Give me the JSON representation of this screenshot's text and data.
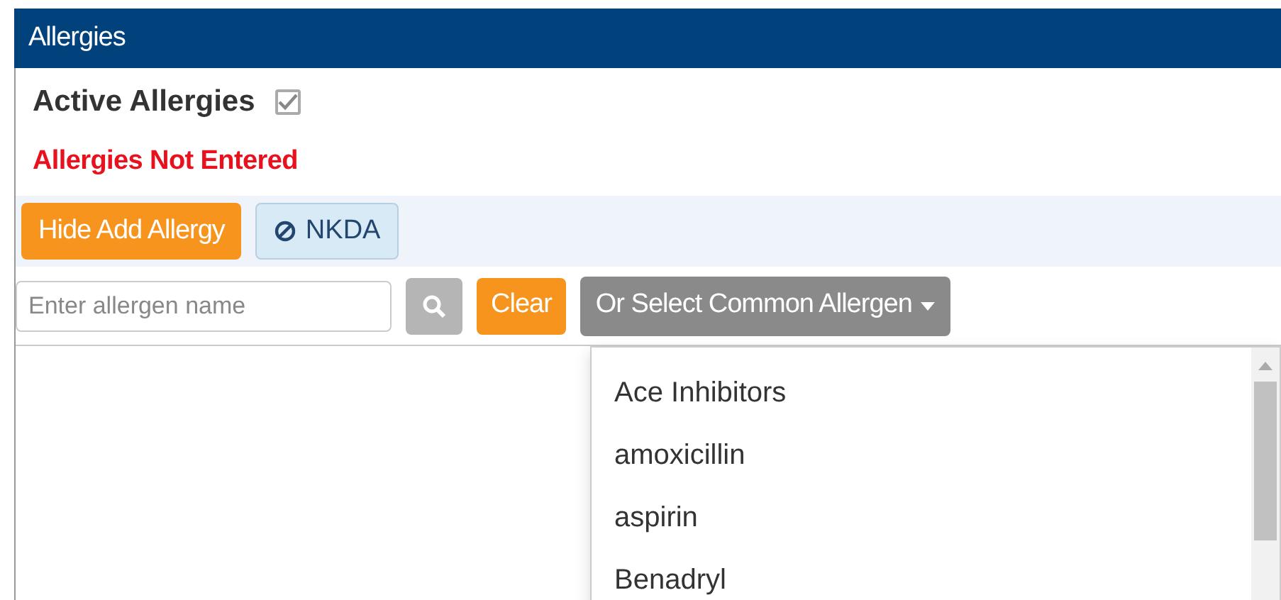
{
  "panel": {
    "title": "Allergies"
  },
  "active_allergies": {
    "label": "Active Allergies",
    "checked": true
  },
  "status": "Allergies Not Entered",
  "actions": [
    {
      "label": "Hide Add Allergy",
      "kind": "primary"
    },
    {
      "label": "NKDA",
      "kind": "nkda"
    }
  ],
  "search": {
    "placeholder": "Enter allergen name",
    "clear": "Clear",
    "common_allergen": "Or Select Common Allergen"
  },
  "allergen_menu": {
    "items": [
      "Ace Inhibitors",
      "amoxicillin",
      "aspirin",
      "Benadryl"
    ]
  }
}
